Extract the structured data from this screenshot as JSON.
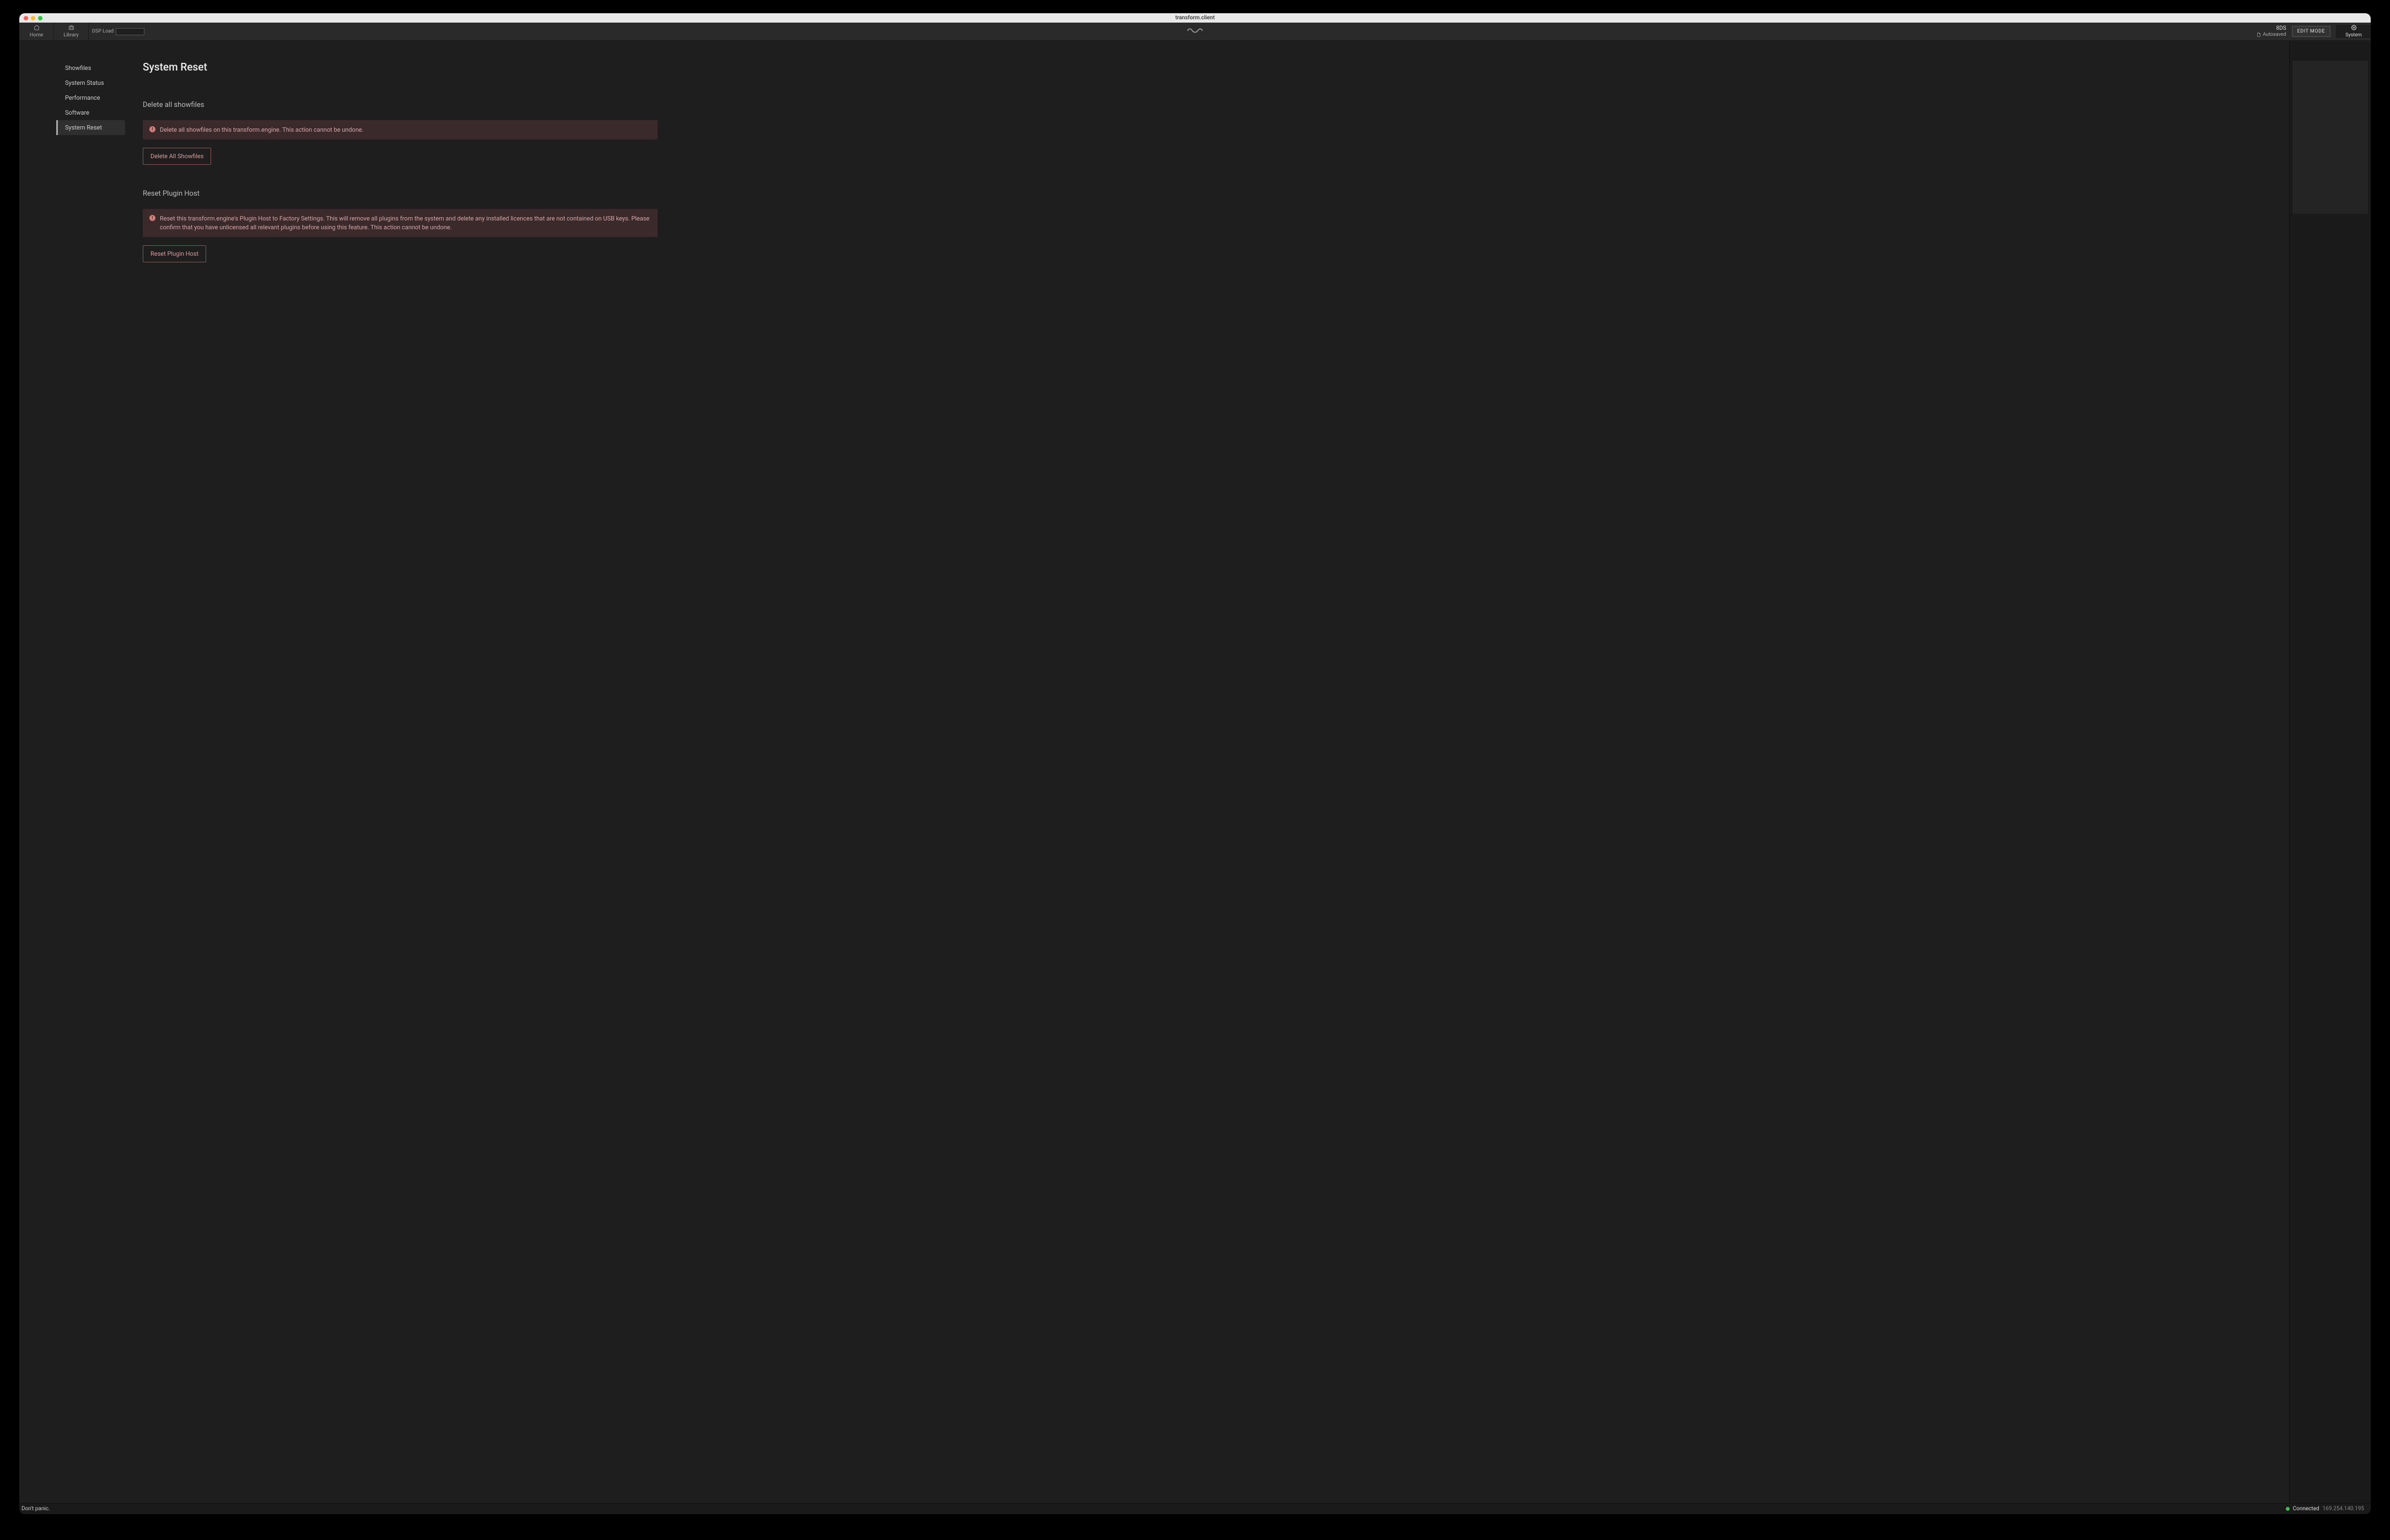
{
  "window": {
    "title": "transform.client"
  },
  "topbar": {
    "tabs": {
      "home": "Home",
      "library": "Library",
      "system": "System"
    },
    "dsp_label": "DSP Load",
    "status_code": "8DS",
    "autosaved": "Autosaved",
    "edit_mode": "EDIT MODE"
  },
  "sidebar": {
    "items": [
      "Showfiles",
      "System Status",
      "Performance",
      "Software",
      "System Reset"
    ]
  },
  "page": {
    "title": "System Reset",
    "sections": {
      "delete_showfiles": {
        "heading": "Delete all showfiles",
        "warning": "Delete all showfiles on this transform.engine. This action cannot be undone.",
        "button": "Delete All Showfiles"
      },
      "reset_plugin_host": {
        "heading": "Reset Plugin Host",
        "warning": "Reset this transform.engine's Plugin Host to Factory Settings. This will remove all plugins from the system and delete any installed licences that are not contained on USB keys. Please confirm that you have unlicensed all relevant plugins before using this feature. This action cannot be undone.",
        "button": "Reset Plugin Host"
      }
    }
  },
  "footer": {
    "left": "Don't panic.",
    "connected": "Connected",
    "ip": "169.254.140.195"
  }
}
